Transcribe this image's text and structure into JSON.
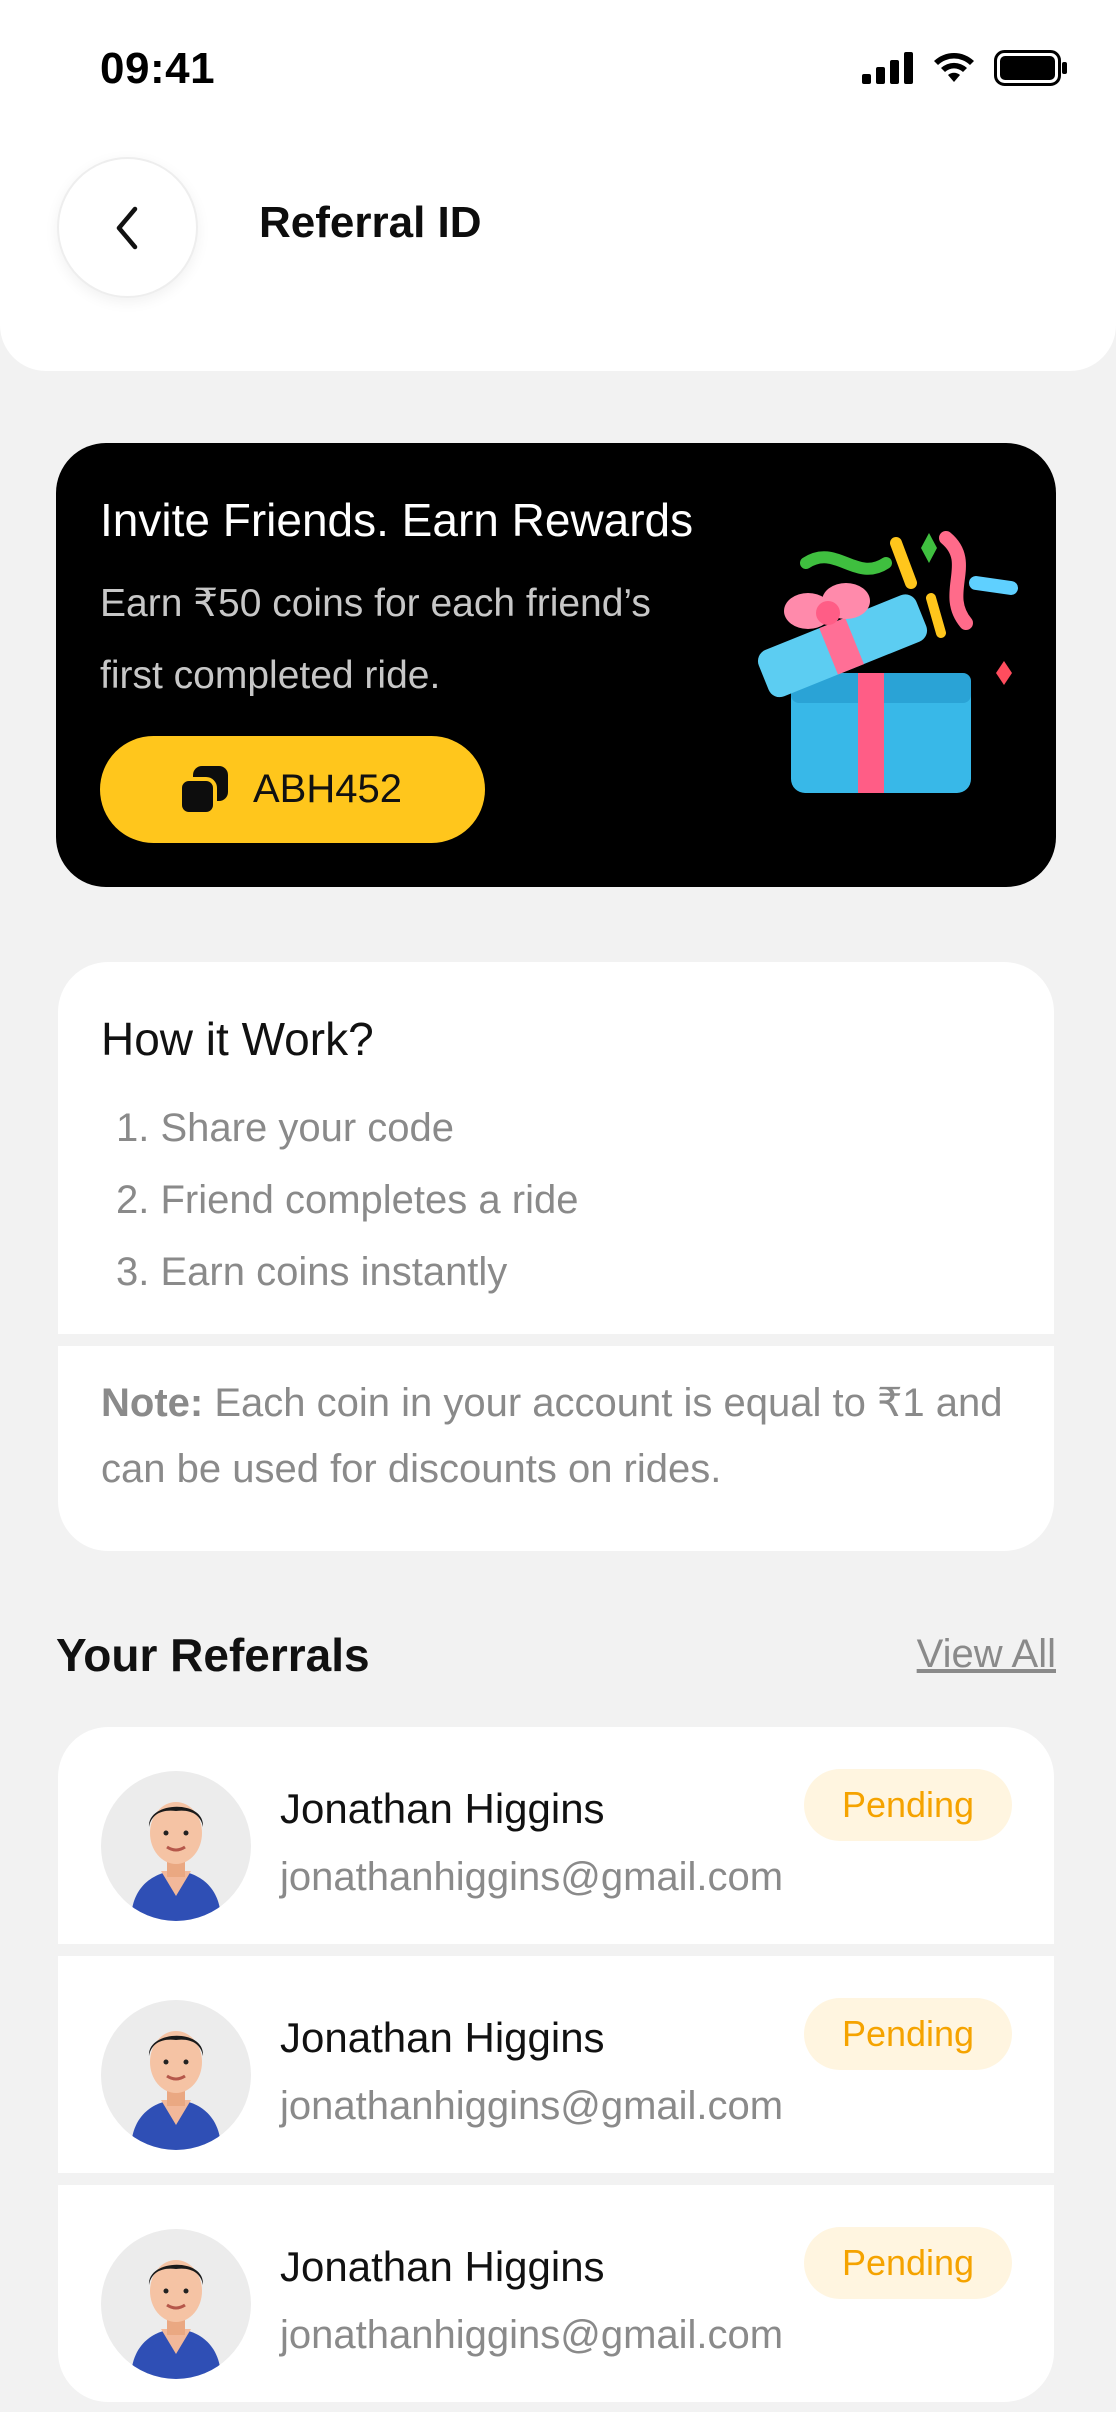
{
  "status_bar": {
    "time": "09:41"
  },
  "header": {
    "title": "Referral ID"
  },
  "promo": {
    "title": "Invite Friends. Earn Rewards",
    "description": "Earn ₹50 coins for each friend’s first completed ride.",
    "code": "ABH452"
  },
  "how_it_works": {
    "title": "How it Work?",
    "steps": [
      "1. Share your code",
      "2. Friend completes a ride",
      "3. Earn coins instantly"
    ],
    "note_label": "Note:",
    "note_text": " Each coin in your account is equal to ₹1 and can be used for discounts on rides."
  },
  "referrals": {
    "title": "Your Referrals",
    "view_all": "View All",
    "items": [
      {
        "name": "Jonathan Higgins",
        "email": "jonathanhiggins@gmail.com",
        "status": "Pending"
      },
      {
        "name": "Jonathan Higgins",
        "email": "jonathanhiggins@gmail.com",
        "status": "Pending"
      },
      {
        "name": "Jonathan Higgins",
        "email": "jonathanhiggins@gmail.com",
        "status": "Pending"
      }
    ]
  },
  "colors": {
    "accent": "#ffc61c",
    "badge_text": "#f5a300",
    "badge_bg": "#fff5e0",
    "promo_bg": "#000000",
    "page_bg": "#f2f2f2"
  },
  "icons": [
    "signal-icon",
    "wifi-icon",
    "battery-icon",
    "back-arrow-icon",
    "copy-icon",
    "gift-illustration",
    "avatar"
  ]
}
